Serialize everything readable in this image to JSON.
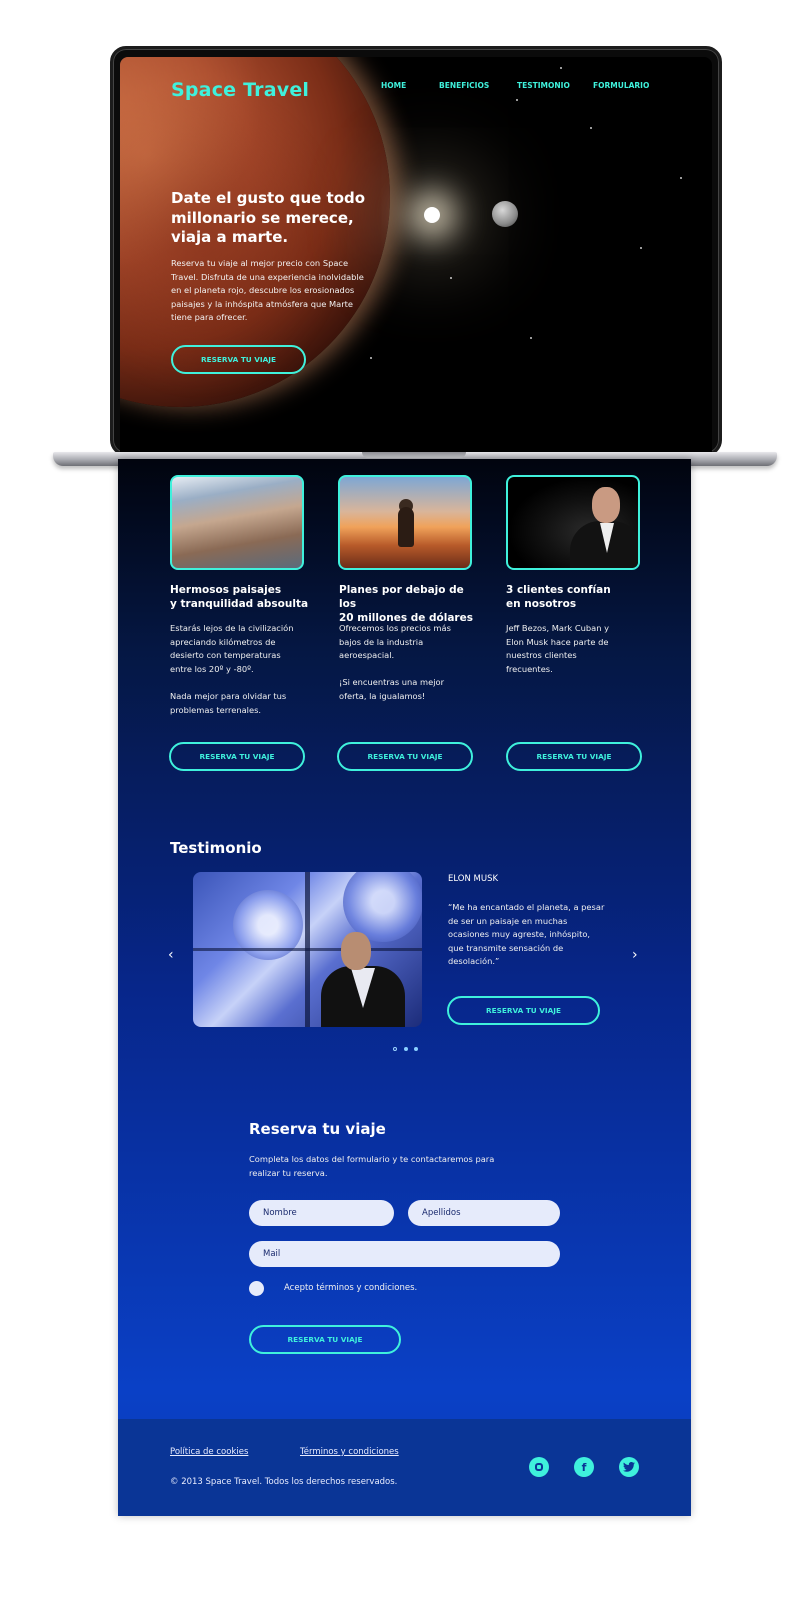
{
  "brand": {
    "logo": "Space Travel",
    "accent": "#3ff1dc"
  },
  "nav": {
    "items": [
      "HOME",
      "BENEFICIOS",
      "TESTIMONIO",
      "FORMULARIO"
    ]
  },
  "hero": {
    "title": "Date el gusto que todo millonario se merece, viaja a marte.",
    "text": "Reserva tu viaje al mejor precio con Space Travel. Disfruta de una experiencia inolvidable en el planeta rojo, descubre los erosionados paisajes y la inhóspita atmósfera que Marte tiene para ofrecer.",
    "cta": "RESERVA TU VIAJE"
  },
  "benefits": [
    {
      "title_line1": "Hermosos paisajes",
      "title_line2": "y tranquilidad absoulta",
      "p1": "Estarás lejos de la civilización apreciando kilómetros de desierto con temperaturas entre los 20º y -80º.",
      "p2": "Nada mejor para olvidar tus problemas terrenales.",
      "cta": "RESERVA TU VIAJE"
    },
    {
      "title_line1": "Planes por debajo de los",
      "title_line2": "20 millones de dólares",
      "p1": "Ofrecemos los precios más bajos de la industria aeroespacial.",
      "p2": "¡Si encuentras una mejor oferta, la igualamos!",
      "cta": "RESERVA TU VIAJE"
    },
    {
      "title_line1": "3 clientes confían",
      "title_line2": "en nosotros",
      "p1": "Jeff Bezos, Mark Cuban y Elon Musk hace parte de nuestros clientes frecuentes.",
      "p2": "",
      "cta": "RESERVA TU VIAJE"
    }
  ],
  "testimonial": {
    "section_title": "Testimonio",
    "name": "ELON MUSK",
    "quote": "“Me ha encantado el planeta, a pesar de ser un paisaje en muchas ocasiones muy agreste, inhóspito, que transmite sensación de desolación.”",
    "cta": "RESERVA TU VIAJE",
    "prev_icon": "‹",
    "next_icon": "›"
  },
  "form": {
    "title": "Reserva tu viaje",
    "description": "Completa los datos del formulario y te contactaremos para realizar tu reserva.",
    "name_placeholder": "Nombre",
    "lastname_placeholder": "Apellidos",
    "mail_placeholder": "Mail",
    "terms_label": "Acepto términos y condiciones.",
    "submit": "RESERVA TU VIAJE"
  },
  "footer": {
    "cookies": "Política de cookies",
    "terms": "Términos y condiciones",
    "copyright": "© 2013 Space Travel. Todos los derechos reservados.",
    "social": [
      "instagram-icon",
      "facebook-icon",
      "twitter-icon"
    ]
  }
}
